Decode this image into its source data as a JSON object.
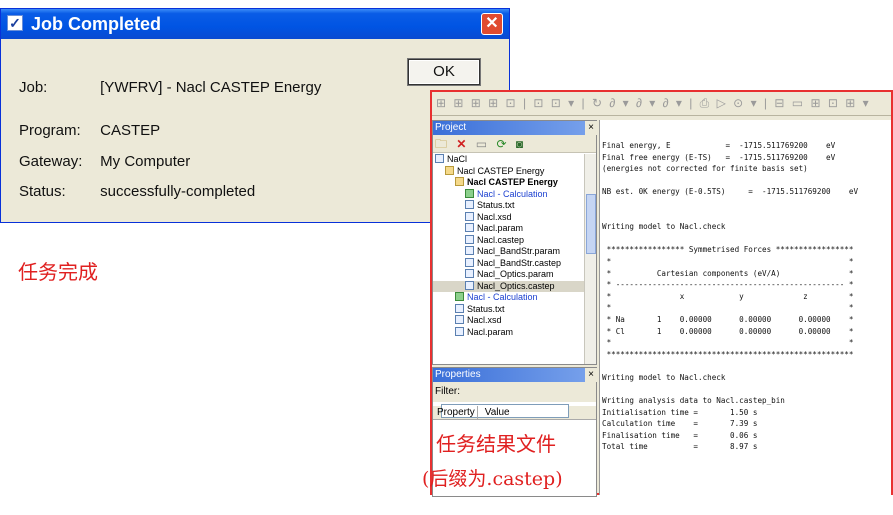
{
  "dialog": {
    "title": "Job Completed",
    "ok_label": "OK",
    "close_glyph": "✕",
    "fields": [
      {
        "label": "Job:",
        "value": "[YWFRV] - Nacl CASTEP Energy"
      },
      {
        "label": "Program:",
        "value": "CASTEP"
      },
      {
        "label": "Gateway:",
        "value": "My Computer"
      },
      {
        "label": "Status:",
        "value": "successfully-completed"
      }
    ]
  },
  "captions": {
    "task_complete": "任务完成",
    "result_file": "任务结果文件",
    "suffix_note": "(后缀为.castep)"
  },
  "project": {
    "title": "Project",
    "tree": [
      {
        "label": "NaCl",
        "indent": 0,
        "kind": "file"
      },
      {
        "label": "Nacl CASTEP Energy",
        "indent": 1,
        "kind": "folder"
      },
      {
        "label": "Nacl CASTEP Energy",
        "indent": 2,
        "kind": "folder",
        "bold": true
      },
      {
        "label": "Nacl - Calculation",
        "indent": 3,
        "kind": "calc",
        "blue": true
      },
      {
        "label": "Status.txt",
        "indent": 3,
        "kind": "file"
      },
      {
        "label": "Nacl.xsd",
        "indent": 3,
        "kind": "file"
      },
      {
        "label": "Nacl.param",
        "indent": 3,
        "kind": "file"
      },
      {
        "label": "Nacl.castep",
        "indent": 3,
        "kind": "file"
      },
      {
        "label": "Nacl_BandStr.param",
        "indent": 3,
        "kind": "file"
      },
      {
        "label": "Nacl_BandStr.castep",
        "indent": 3,
        "kind": "file"
      },
      {
        "label": "Nacl_Optics.param",
        "indent": 3,
        "kind": "file"
      },
      {
        "label": "Nacl_Optics.castep",
        "indent": 3,
        "kind": "file",
        "selected": true
      },
      {
        "label": "Nacl - Calculation",
        "indent": 2,
        "kind": "calc",
        "blue": true
      },
      {
        "label": "Status.txt",
        "indent": 2,
        "kind": "file"
      },
      {
        "label": "Nacl.xsd",
        "indent": 2,
        "kind": "file"
      },
      {
        "label": "Nacl.param",
        "indent": 2,
        "kind": "file"
      }
    ]
  },
  "properties": {
    "title": "Properties",
    "filter_label": "Filter:",
    "col_property": "Property",
    "col_value": "Value"
  },
  "output_lines": [
    "Final energy, E            =  -1715.511769200    eV",
    "Final free energy (E-TS)   =  -1715.511769200    eV",
    "(energies not corrected for finite basis set)",
    "",
    "NB est. 0K energy (E-0.5TS)     =  -1715.511769200    eV",
    "",
    "",
    "Writing model to Nacl.check",
    "",
    " ***************** Symmetrised Forces *****************",
    " *                                                    *",
    " *          Cartesian components (eV/A)               *",
    " * -------------------------------------------------- *",
    " *               x            y             z         *",
    " *                                                    *",
    " * Na       1    0.00000      0.00000      0.00000    *",
    " * Cl       1    0.00000      0.00000      0.00000    *",
    " *                                                    *",
    " ******************************************************",
    "",
    "Writing model to Nacl.check",
    "",
    "Writing analysis data to Nacl.castep_bin",
    "Initialisation time =       1.50 s",
    "Calculation time    =       7.39 s",
    "Finalisation time   =       0.06 s",
    "Total time          =       8.97 s"
  ]
}
